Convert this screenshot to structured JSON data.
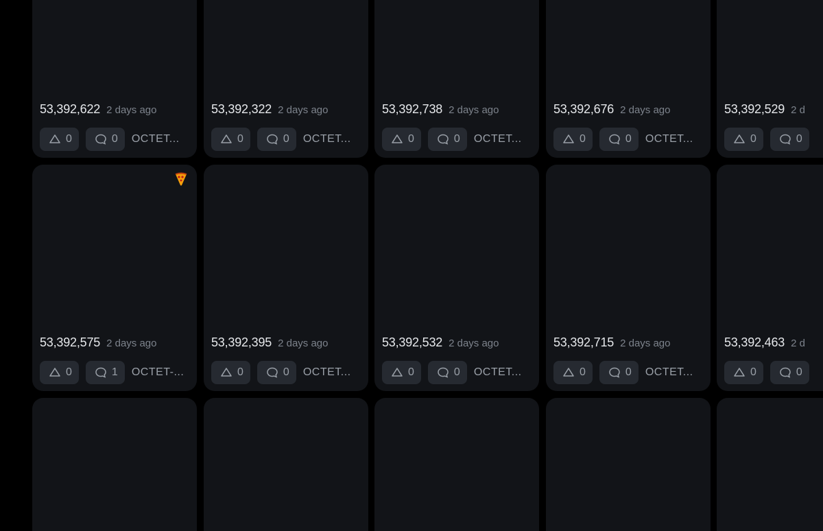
{
  "cards": [
    {
      "number": "53,392,622",
      "time": "2 days ago",
      "upvotes": "0",
      "comments": "0",
      "tag": "OCTET..."
    },
    {
      "number": "53,392,322",
      "time": "2 days ago",
      "upvotes": "0",
      "comments": "0",
      "tag": "OCTET..."
    },
    {
      "number": "53,392,738",
      "time": "2 days ago",
      "upvotes": "0",
      "comments": "0",
      "tag": "OCTET..."
    },
    {
      "number": "53,392,676",
      "time": "2 days ago",
      "upvotes": "0",
      "comments": "0",
      "tag": "OCTET..."
    },
    {
      "number": "53,392,529",
      "time": "2 d",
      "upvotes": "0",
      "comments": "0",
      "tag": ""
    },
    {
      "number": "53,392,575",
      "time": "2 days ago",
      "upvotes": "0",
      "comments": "1",
      "tag": "OCTET-...",
      "badge": "pizza-icon"
    },
    {
      "number": "53,392,395",
      "time": "2 days ago",
      "upvotes": "0",
      "comments": "0",
      "tag": "OCTET..."
    },
    {
      "number": "53,392,532",
      "time": "2 days ago",
      "upvotes": "0",
      "comments": "0",
      "tag": "OCTET..."
    },
    {
      "number": "53,392,715",
      "time": "2 days ago",
      "upvotes": "0",
      "comments": "0",
      "tag": "OCTET..."
    },
    {
      "number": "53,392,463",
      "time": "2 d",
      "upvotes": "0",
      "comments": "0",
      "tag": ""
    },
    {},
    {},
    {},
    {},
    {}
  ],
  "colors": {
    "page_bg": "#000000",
    "card_bg": "#121418",
    "pill_bg": "#262a31",
    "text_primary": "#e6e8eb",
    "text_secondary": "#7d838c",
    "pizza": "#f59e0b"
  },
  "icons": {
    "upvote": "triangle-up-icon",
    "comment": "speech-bubble-icon"
  }
}
